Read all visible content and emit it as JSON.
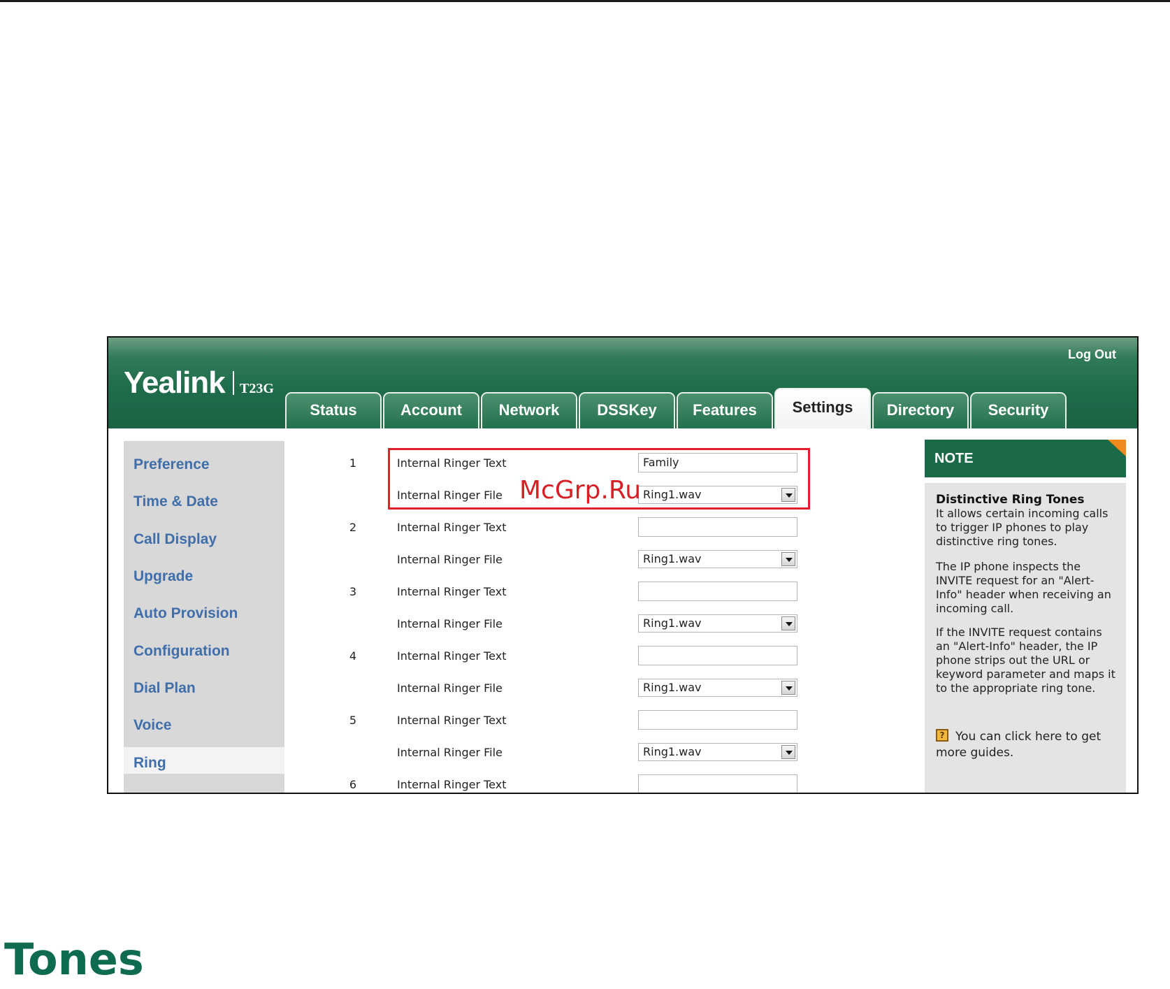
{
  "header": {
    "brand": "Yealink",
    "model": "T23G",
    "logout_label": "Log Out"
  },
  "tabs": [
    {
      "label": "Status",
      "active": false
    },
    {
      "label": "Account",
      "active": false
    },
    {
      "label": "Network",
      "active": false
    },
    {
      "label": "DSSKey",
      "active": false
    },
    {
      "label": "Features",
      "active": false
    },
    {
      "label": "Settings",
      "active": true
    },
    {
      "label": "Directory",
      "active": false
    },
    {
      "label": "Security",
      "active": false
    }
  ],
  "sidebar": {
    "items": [
      {
        "label": "Preference"
      },
      {
        "label": "Time & Date"
      },
      {
        "label": "Call Display"
      },
      {
        "label": "Upgrade"
      },
      {
        "label": "Auto Provision"
      },
      {
        "label": "Configuration"
      },
      {
        "label": "Dial Plan"
      },
      {
        "label": "Voice"
      },
      {
        "label": "Ring"
      }
    ],
    "active": "Ring"
  },
  "ringers": [
    {
      "number": "1",
      "text_label": "Internal Ringer Text",
      "text_value": "Family",
      "file_label": "Internal Ringer File",
      "file_value": "Ring1.wav"
    },
    {
      "number": "2",
      "text_label": "Internal Ringer Text",
      "text_value": "",
      "file_label": "Internal Ringer File",
      "file_value": "Ring1.wav"
    },
    {
      "number": "3",
      "text_label": "Internal Ringer Text",
      "text_value": "",
      "file_label": "Internal Ringer File",
      "file_value": "Ring1.wav"
    },
    {
      "number": "4",
      "text_label": "Internal Ringer Text",
      "text_value": "",
      "file_label": "Internal Ringer File",
      "file_value": "Ring1.wav"
    },
    {
      "number": "5",
      "text_label": "Internal Ringer Text",
      "text_value": "",
      "file_label": "Internal Ringer File",
      "file_value": "Ring1.wav"
    },
    {
      "number": "6",
      "text_label": "Internal Ringer Text",
      "text_value": ""
    }
  ],
  "watermark": "McGrp.Ru",
  "note": {
    "title": "NOTE",
    "heading": "Distinctive Ring Tones",
    "paragraphs": [
      "It allows certain incoming calls to trigger IP phones to play distinctive ring tones.",
      "The IP phone inspects the INVITE request for an \"Alert-Info\" header when receiving an incoming call.",
      "If the INVITE request contains an \"Alert-Info\" header, the IP phone strips out the URL or keyword parameter and maps it to the appropriate ring tone."
    ],
    "guide_text": "You can click here to get more guides."
  },
  "caption": "Tones",
  "colors": {
    "header_green": "#1a6344",
    "highlight_red": "#e0202a",
    "sidebar_link": "#3f6eaa",
    "note_accent": "#f08a1c",
    "caption_green": "#0f6b50"
  }
}
